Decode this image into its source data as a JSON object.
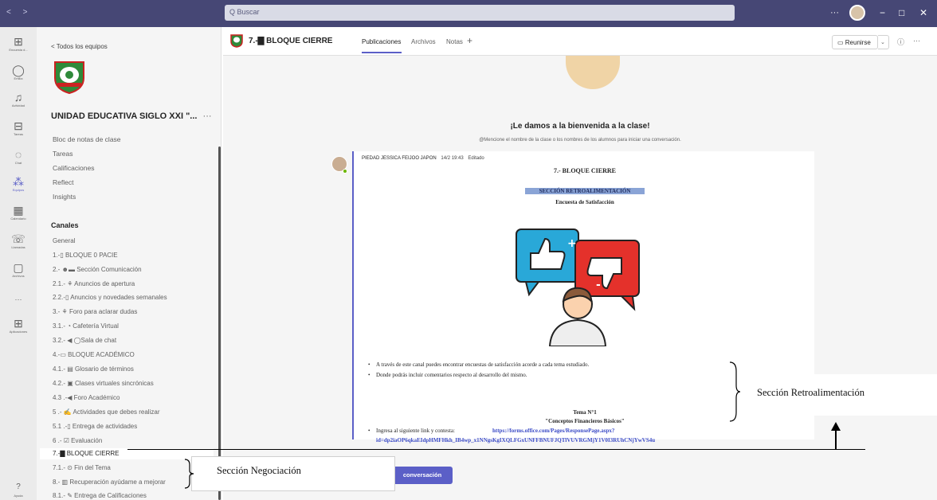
{
  "titlebar": {
    "nav_arrows": "< >",
    "search_placeholder": "Q Buscar",
    "more": "···",
    "window_controls": [
      "−",
      "□",
      "✕"
    ]
  },
  "rail": {
    "items": [
      {
        "icon": "grid-icon",
        "glyph": "⊞",
        "label": "Encuesta d..."
      },
      {
        "icon": "bell-ring-icon",
        "glyph": "◯",
        "label": "Emilia"
      },
      {
        "icon": "bell-icon",
        "glyph": "♫",
        "label": "Actividad"
      },
      {
        "icon": "clipboard-icon",
        "glyph": "⊟",
        "label": "Tareas"
      },
      {
        "icon": "chat-icon",
        "glyph": "◌",
        "label": "Chat"
      },
      {
        "icon": "teams-icon",
        "glyph": "⁂",
        "label": "Equipos"
      },
      {
        "icon": "calendar-icon",
        "glyph": "▦",
        "label": "Calendario"
      },
      {
        "icon": "phone-icon",
        "glyph": "☏",
        "label": "Llamadas"
      },
      {
        "icon": "file-icon",
        "glyph": "▢",
        "label": "Archivos"
      },
      {
        "icon": "more-icon",
        "glyph": "···",
        "label": ""
      },
      {
        "icon": "apps-icon",
        "glyph": "⊞",
        "label": "Aplicaciones"
      }
    ],
    "help": {
      "glyph": "?",
      "label": "Ayuda"
    }
  },
  "team_panel": {
    "back_label": "< Todos los equipos",
    "team_name": "UNIDAD EDUCATIVA SIGLO XXI \"...",
    "team_more": "···",
    "links": [
      "Bloc de notas de clase",
      "Tareas",
      "Calificaciones",
      "Reflect",
      "Insights"
    ],
    "channels_heading": "Canales",
    "channels": [
      "General",
      "1.-▯ BLOQUE 0 PACIE",
      "2.- ☻▬ Sección Comunicación",
      "2.1.- ⚘ Anuncios de apertura",
      "2.2.-▯ Anuncios y novedades semanales",
      "3.- ⚘ Foro para aclarar dudas",
      "3.1.- ◔ Cafetería Virtual",
      "3.2.- ◀ ◯Sala de chat",
      "4.-▭ BLOQUE ACADÉMICO",
      "4.1.- ▤ Glosario de términos",
      "4.2.- ▣ Clases virtuales sincrónicas",
      "4.3 .-◀ Foro Académico",
      "5 .- ✍ Actividades que debes realizar",
      "5.1 .-▯ Entrega de actividades",
      "6 .- ☑ Evaluación",
      "7.-▇ BLOQUE CIERRE",
      "7.1.- ⊙ Fin del Tema",
      "8.- ▥ Recuperación ayúdame a mejorar",
      "8.1.- ✎ Entrega de Calificaciones"
    ]
  },
  "channel_header": {
    "title": "7.-▇ BLOQUE CIERRE",
    "tabs": [
      "Publicaciones",
      "Archivos",
      "Notas",
      "+"
    ],
    "meet_label": "▭ Reunirse",
    "meet_dropdown": "⌄",
    "info": "ⓘ",
    "more": "···"
  },
  "feed": {
    "welcome_title": "¡Le damos a la bienvenida a la clase!",
    "welcome_sub": "@Mencione el nombre de la clase o los nombres de los alumnos para iniciar una conversación.",
    "post": {
      "author": "PIEDAD JESSICA FEIJOO JAPON",
      "time": "14/2 19:43",
      "edited": "Editado",
      "title": "7.- BLOQUE CIERRE",
      "section": "SECCIÓN RETROALIMENTACIÓN",
      "survey": "Encuesta de Satisfacción",
      "bullet1": "A través de este canal puedes encontrar encuestas de satisfacción acorde a cada tema estudiado.",
      "bullet2": "Donde podrás incluir comentarios respecto al desarrollo del mismo.",
      "tema": "Tema N°1",
      "concept": "\"Conceptos Financieros Básicos\"",
      "link_label": "Ingresa al siguiente link y contesta:",
      "link_part1": "https://forms.office.com/Pages/ResponsePage.aspx?",
      "link_part2": "id=dp2iaOP6qkaEIdpHMFHkh_IB4wp_x1NNgsKgIXQLFGxUNFFBNUFJQTlVUVRGMjY1V0I3RUhCNjYwVS4u"
    },
    "new_conversation": "conversación"
  },
  "annotations": {
    "negociacion": "Sección Negociación",
    "retroalimentacion": "Sección Retroalimentación"
  },
  "colors": {
    "titlebar": "#464775",
    "accent": "#5b5fc7",
    "rail": "#ebebeb",
    "panel": "#f5f5f5"
  }
}
